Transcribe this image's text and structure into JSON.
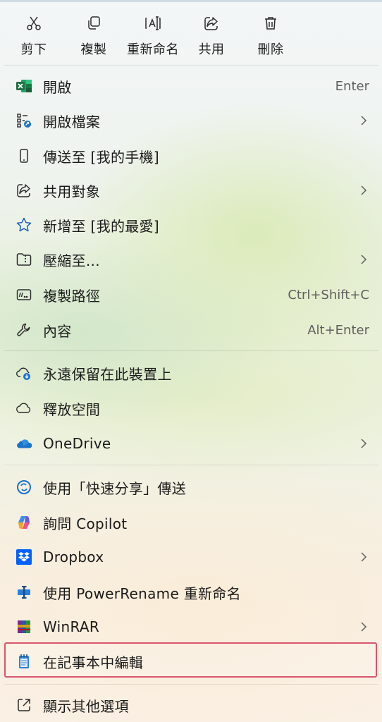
{
  "actions": [
    {
      "label": "剪下",
      "icon": "cut-icon"
    },
    {
      "label": "複製",
      "icon": "copy-icon"
    },
    {
      "label": "重新命名",
      "icon": "rename-icon"
    },
    {
      "label": "共用",
      "icon": "share-icon"
    },
    {
      "label": "刪除",
      "icon": "delete-icon"
    }
  ],
  "items": [
    {
      "label": "開啟",
      "accel": "Enter",
      "icon": "excel-icon"
    },
    {
      "label": "開啟檔案",
      "submenu": true,
      "icon": "open-with-icon"
    },
    {
      "label": "傳送至 [我的手機]",
      "icon": "phone-icon"
    },
    {
      "label": "共用對象",
      "submenu": true,
      "icon": "share-icon"
    },
    {
      "label": "新增至 [我的最愛]",
      "icon": "star-icon"
    },
    {
      "label": "壓縮至...",
      "submenu": true,
      "icon": "zip-folder-icon"
    },
    {
      "label": "複製路徑",
      "accel": "Ctrl+Shift+C",
      "icon": "copy-path-icon"
    },
    {
      "label": "內容",
      "accel": "Alt+Enter",
      "icon": "wrench-icon"
    },
    {
      "label": "永遠保留在此裝置上",
      "icon": "cloud-download-icon"
    },
    {
      "label": "釋放空間",
      "icon": "cloud-icon"
    },
    {
      "label": "OneDrive",
      "submenu": true,
      "icon": "onedrive-icon"
    },
    {
      "label": "使用「快速分享」傳送",
      "icon": "quick-share-icon"
    },
    {
      "label": "詢問 Copilot",
      "icon": "copilot-icon"
    },
    {
      "label": "Dropbox",
      "submenu": true,
      "icon": "dropbox-icon"
    },
    {
      "label": "使用 PowerRename 重新命名",
      "icon": "powerrename-icon"
    },
    {
      "label": "WinRAR",
      "submenu": true,
      "icon": "winrar-icon"
    },
    {
      "label": "在記事本中編輯",
      "icon": "notepad-icon",
      "highlighted": true
    },
    {
      "label": "顯示其他選項",
      "icon": "more-options-icon"
    }
  ],
  "colors": {
    "highlight_border": "#d9566e",
    "accent_blue": "#1a73c9",
    "excel_green": "#1d7044",
    "dropbox_blue": "#0061fe"
  }
}
